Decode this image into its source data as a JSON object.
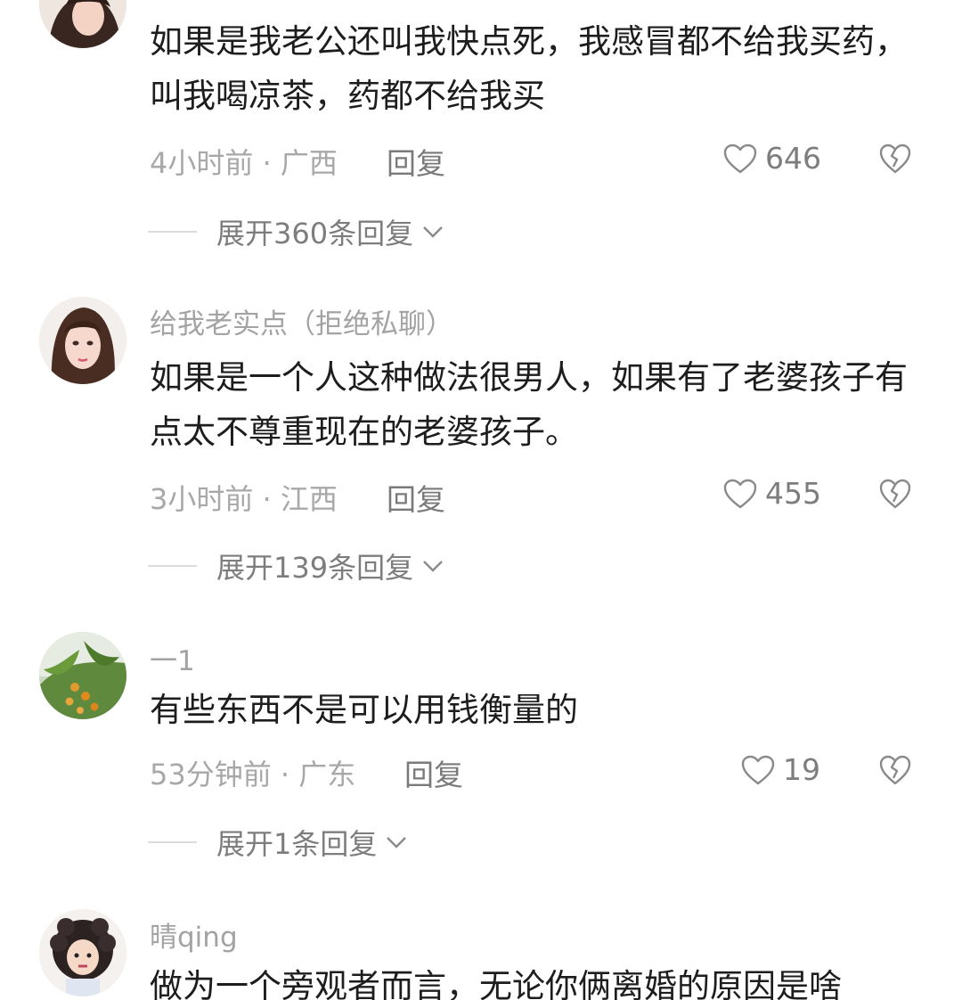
{
  "comments": [
    {
      "username": "",
      "text": "如果是我老公还叫我快点死，我感冒都不给我买药，叫我喝凉茶，药都不给我买",
      "meta": "4小时前 · 广西",
      "reply_label": "回复",
      "likes": "646",
      "expand_label": "展开360条回复"
    },
    {
      "username": "给我老实点（拒绝私聊）",
      "text": "如果是一个人这种做法很男人，如果有了老婆孩子有点太不尊重现在的老婆孩子。",
      "meta": "3小时前 · 江西",
      "reply_label": "回复",
      "likes": "455",
      "expand_label": "展开139条回复"
    },
    {
      "username": "一1",
      "text": "有些东西不是可以用钱衡量的",
      "meta": "53分钟前 · 广东",
      "reply_label": "回复",
      "likes": "19",
      "expand_label": "展开1条回复"
    },
    {
      "username": "晴qing",
      "text": "做为一个旁观者而言，无论你俩离婚的原因是啥"
    }
  ],
  "icons": {
    "like": "heart-outline-icon",
    "dislike": "broken-heart-icon",
    "expand": "chevron-down-icon"
  },
  "colors": {
    "text": "#1d1d1d",
    "secondary": "#a8a8a8",
    "action": "#7d7d7d"
  }
}
